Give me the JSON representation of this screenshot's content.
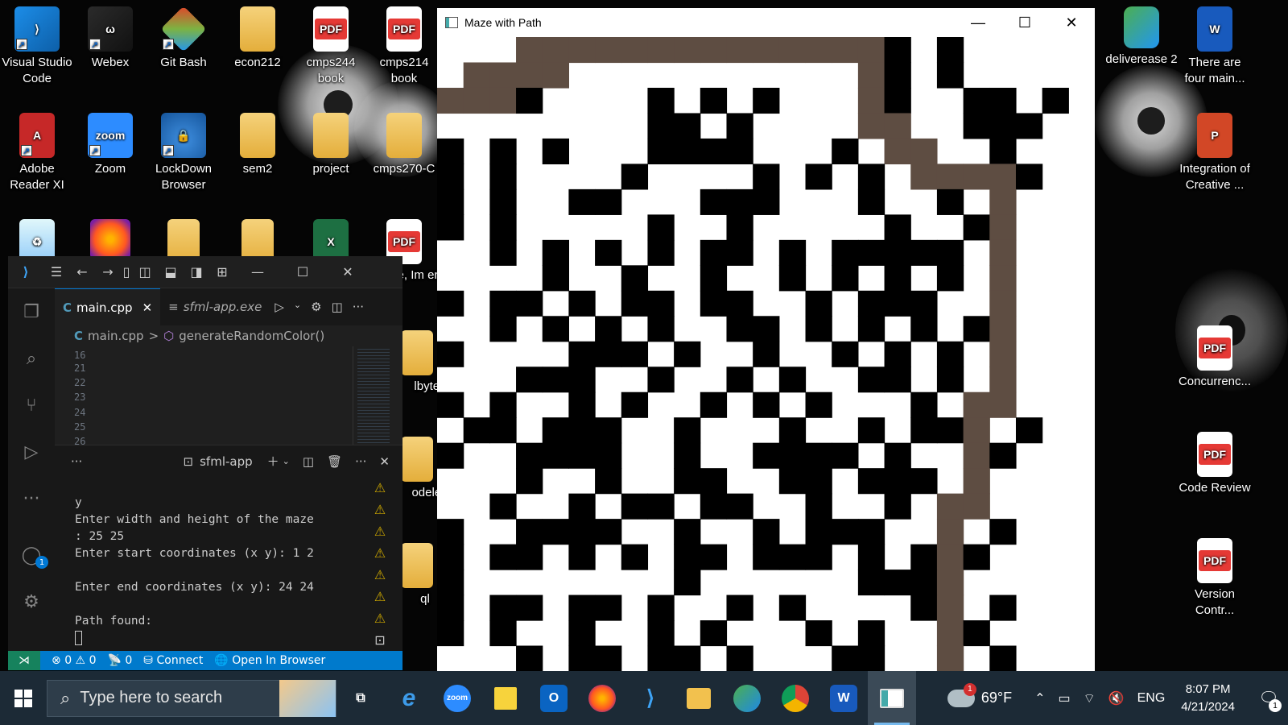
{
  "desktop": {
    "icons": [
      {
        "label": "Visual Studio Code",
        "icon": "vscode-icon"
      },
      {
        "label": "Webex",
        "icon": "webex-icon"
      },
      {
        "label": "Git Bash",
        "icon": "git-bash-icon"
      },
      {
        "label": "econ212",
        "icon": "folder-icon"
      },
      {
        "label": "cmps244 book",
        "icon": "pdf-icon"
      },
      {
        "label": "cmps214 book",
        "icon": "pdf-icon"
      },
      {
        "label": "Adobe Reader XI",
        "icon": "adobe-reader-icon"
      },
      {
        "label": "Zoom",
        "icon": "zoom-icon"
      },
      {
        "label": "LockDown Browser",
        "icon": "lockdown-browser-icon"
      },
      {
        "label": "sem2",
        "icon": "folder-icon"
      },
      {
        "label": "project",
        "icon": "folder-icon"
      },
      {
        "label": "cmps270-C",
        "icon": "folder-icon"
      },
      {
        "label": "deliverease 2",
        "icon": "edge-icon"
      },
      {
        "label": "There are four main...",
        "icon": "word-icon"
      },
      {
        "label": "Integration of Creative ...",
        "icon": "powerpoint-icon"
      },
      {
        "label": "Concurrenc...",
        "icon": "pdf-icon"
      },
      {
        "label": "Code Review",
        "icon": "pdf-icon"
      },
      {
        "label": "Version Contr...",
        "icon": "pdf-icon"
      },
      {
        "label": "Me, Im entist",
        "icon": "pdf-icon"
      },
      {
        "label": "lbytes",
        "icon": "folder-icon"
      },
      {
        "label": "odele..",
        "icon": "folder-icon"
      },
      {
        "label": "ql",
        "icon": "folder-icon"
      }
    ],
    "pdf_tag": "PDF",
    "zoom_tag": "zoom"
  },
  "maze_window": {
    "title": "Maze with Path",
    "grid_size": 25,
    "colors": {
      "wall": "#000000",
      "open": "#ffffff",
      "path": "#5e4d42"
    },
    "maze_rows": [
      "....#............#.#.....",
      "....#............#.#.....",
      "#.##....#.#.#...##..##.#.",
      "........##.#....##..###..",
      "#.#.#...####...#.#...#...",
      "#.#....#....#.#.#.....#..",
      "#.#..##...###...#..#.....",
      "#.#.....#..#.....#..##...",
      "..#.#.#.#.##.#.#####.#...",
      "....#..#..#..#.#.#.#.#...",
      "#.##.#.##.##..#.###......",
      "..#.#.#.#..##.#.#.#.#....",
      "#....###.#..#..#.#.#.....",
      "...###..#..#.#..##.#.#...",
      "#.#..#.#..#.#.#...#.##...",
      ".##.###..#...#..#.##..#..",
      "#..####..#..####.#..##...",
      "...#..#..##..##.###.#....",
      "..#..#.##.##..#..#.##....",
      "#..####..#..#.###..#.#...",
      "#.##.#.#.##.###.#.#.#....",
      "#........#......###......",
      "#.##.##.#..#.#....#..#...",
      "#.#..#..#.#...#.#...#....",
      "...#.##.##.#...##..#.#..."
    ],
    "path_cells": [
      [
        3,
        0
      ],
      [
        4,
        0
      ],
      [
        5,
        0
      ],
      [
        6,
        0
      ],
      [
        7,
        0
      ],
      [
        8,
        0
      ],
      [
        9,
        0
      ],
      [
        10,
        0
      ],
      [
        11,
        0
      ],
      [
        12,
        0
      ],
      [
        13,
        0
      ],
      [
        14,
        0
      ],
      [
        15,
        0
      ],
      [
        16,
        0
      ],
      [
        1,
        1
      ],
      [
        2,
        1
      ],
      [
        3,
        1
      ],
      [
        4,
        1
      ],
      [
        16,
        1
      ],
      [
        0,
        2
      ],
      [
        1,
        2
      ],
      [
        2,
        2
      ],
      [
        16,
        2
      ],
      [
        16,
        3
      ],
      [
        17,
        3
      ],
      [
        17,
        4
      ],
      [
        18,
        4
      ],
      [
        18,
        5
      ],
      [
        19,
        5
      ],
      [
        20,
        5
      ],
      [
        21,
        5
      ],
      [
        21,
        6
      ],
      [
        21,
        7
      ],
      [
        21,
        8
      ],
      [
        21,
        9
      ],
      [
        21,
        10
      ],
      [
        21,
        11
      ],
      [
        21,
        12
      ],
      [
        21,
        13
      ],
      [
        21,
        14
      ],
      [
        20,
        14
      ],
      [
        20,
        15
      ],
      [
        20,
        16
      ],
      [
        20,
        17
      ],
      [
        20,
        18
      ],
      [
        19,
        18
      ],
      [
        19,
        19
      ],
      [
        19,
        20
      ],
      [
        19,
        21
      ],
      [
        19,
        22
      ],
      [
        19,
        23
      ],
      [
        19,
        24
      ]
    ]
  },
  "vscode": {
    "tabs": [
      {
        "label": "main.cpp",
        "active": true
      },
      {
        "label": "sfml-app.exe",
        "active": false
      }
    ],
    "breadcrumb": {
      "file": "main.cpp",
      "separator": ">",
      "symbol": "generateRandomColor()"
    },
    "line_numbers": [
      "16",
      "21",
      "22",
      "23",
      "24",
      "25",
      "26"
    ],
    "terminal_name": "sfml-app",
    "terminal_lines": [
      "y",
      "Enter width and height of the maze",
      ": 25 25",
      "Enter start coordinates (x y): 1 2",
      "",
      "Enter end coordinates (x y): 24 24",
      "",
      "Path found:"
    ],
    "accounts_badge": "1",
    "status": {
      "errors": "0",
      "warnings": "0",
      "ports": "0",
      "connect": "Connect",
      "open_in_browser": "Open In Browser"
    }
  },
  "taskbar": {
    "search_placeholder": "Type here to search",
    "apps": [
      {
        "name": "task-view-icon",
        "label": ""
      },
      {
        "name": "internet-explorer-icon",
        "label": "e"
      },
      {
        "name": "zoom-icon",
        "label": "zoom"
      },
      {
        "name": "sticky-notes-icon",
        "label": ""
      },
      {
        "name": "outlook-icon",
        "label": "O"
      },
      {
        "name": "firefox-icon",
        "label": ""
      },
      {
        "name": "vscode-icon",
        "label": ""
      },
      {
        "name": "file-explorer-icon",
        "label": ""
      },
      {
        "name": "edge-icon",
        "label": ""
      },
      {
        "name": "chrome-icon",
        "label": ""
      },
      {
        "name": "word-icon",
        "label": "W"
      },
      {
        "name": "maze-app-icon",
        "label": ""
      }
    ],
    "weather_temp": "69°F",
    "weather_badge": "1",
    "language": "ENG",
    "time": "8:07 PM",
    "date": "4/21/2024",
    "notification_badge": "1"
  }
}
